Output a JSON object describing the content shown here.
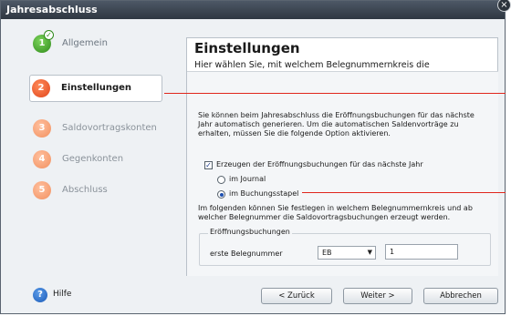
{
  "window": {
    "title": "Jahresabschluss",
    "close_glyph": "×"
  },
  "steps": [
    {
      "number": "1",
      "label": "Allgemein",
      "state": "done"
    },
    {
      "number": "2",
      "label": "Einstellungen",
      "state": "active"
    },
    {
      "number": "3",
      "label": "Saldovortragskonten",
      "state": "pending"
    },
    {
      "number": "4",
      "label": "Gegenkonten",
      "state": "pending"
    },
    {
      "number": "5",
      "label": "Abschluss",
      "state": "pending"
    }
  ],
  "panel": {
    "title": "Einstellungen",
    "subtitle": "Hier wählen Sie, mit welchem Belegnummernkreis die Eröffnungsbuchungen im Stapel oder Journal vorgetragen werden."
  },
  "options": {
    "description": "Sie können beim Jahresabschluss die Eröffnungsbuchungen für das nächste Jahr automatisch generieren. Um die automatischen Saldenvorträge zu erhalten, müssen Sie die folgende Option aktivieren.",
    "checkbox_label": "Erzeugen der Eröffnungsbuchungen für das nächste Jahr",
    "checkbox_checked": true,
    "radio_journal": "im Journal",
    "radio_stapel": "im Buchungsstapel",
    "selected_radio": "im Buchungsstapel",
    "description2": "Im folgenden können Sie festlegen in welchem Belegnummernkreis und ab welcher Belegnummer die Saldovortragsbuchungen erzeugt werden.",
    "group_label": "Eröffnungsbuchungen",
    "field_label": "erste Belegnummer",
    "select_value": "EB",
    "number_value": "1"
  },
  "footer": {
    "help": "Hilfe",
    "back": "< Zurück",
    "next": "Weiter >",
    "cancel": "Abbrechen"
  },
  "colors": {
    "annotation": "#e0261c",
    "title_bar": "#3b4450"
  }
}
